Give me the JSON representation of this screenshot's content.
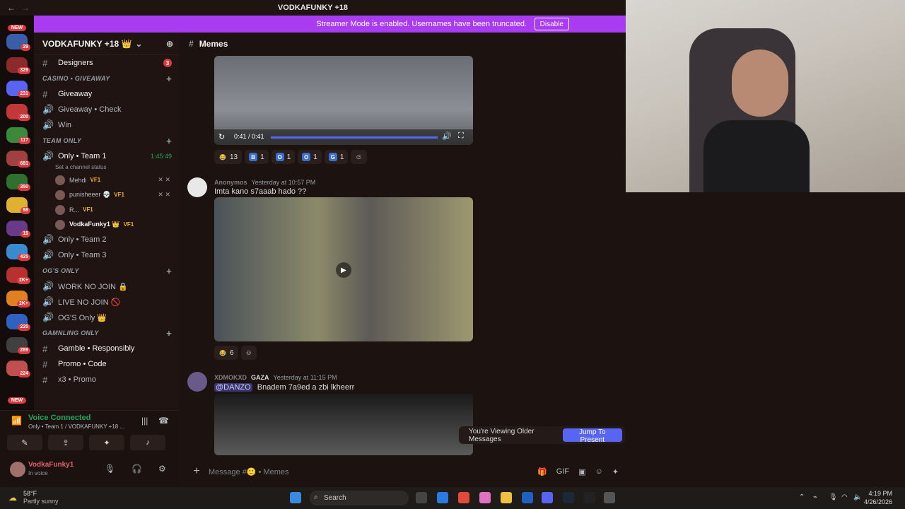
{
  "titlebar": {
    "title": "VODKAFUNKY +18"
  },
  "banner": {
    "text": "Streamer Mode is enabled. Usernames have been truncated.",
    "button": "Disable"
  },
  "server_rail": {
    "new_top": "NEW",
    "new_bottom": "NEW",
    "badges": [
      "29",
      "329",
      "231",
      "200",
      "117",
      "681",
      "350",
      "98",
      "15",
      "425",
      "2K+",
      "2K+",
      "220",
      "289",
      "224"
    ]
  },
  "sidebar": {
    "server_name": "VODKAFUNKY +18 👑",
    "channels": {
      "designers": {
        "label": "Designers",
        "count": "3"
      },
      "cat_casino": "CASINO • GIVEAWAY",
      "giveaway": "Giveaway",
      "giveaway_check": "Giveaway • Check",
      "win": "Win",
      "cat_team": "TEAM ONLY",
      "team1": {
        "label": "Only • Team 1",
        "timer": "1:45:49",
        "status": "Set a channel status"
      },
      "users": [
        {
          "name": "Mehdi",
          "tag": "VF1"
        },
        {
          "name": "punisheeer 💀",
          "tag": "VF1"
        },
        {
          "name": "R...",
          "tag": "VF1"
        },
        {
          "name": "VodkaFunky1 👑",
          "tag": "VF1"
        }
      ],
      "team2": "Only • Team 2",
      "team3": "Only • Team 3",
      "cat_ogs": "OG'S ONLY",
      "work": "WORK NO JOIN 🔒",
      "live": "LIVE NO JOIN 🚫",
      "ogs_only": "OG'S Only 👑",
      "cat_gambling": "GAMNLING ONLY",
      "gamble": "Gamble • Responsibly",
      "promo": "Promo • Code",
      "x3": "x3 • Promo"
    }
  },
  "voice": {
    "title": "Voice Connected",
    "sub": "Only • Team 1 / VODKAFUNKY +18 ..."
  },
  "user_panel": {
    "name": "VodkaFunky1",
    "status": "In voice"
  },
  "chat": {
    "channel": "Memes",
    "video1": {
      "time": "0:41 / 0:41"
    },
    "reactions1": [
      {
        "e": "😂",
        "c": "13"
      },
      {
        "e": "B",
        "c": "1"
      },
      {
        "e": "O",
        "c": "1"
      },
      {
        "e": "O",
        "c": "1"
      },
      {
        "e": "G",
        "c": "1"
      }
    ],
    "msg2": {
      "author": "Anonymos",
      "time": "Yesterday at 10:57 PM",
      "text": "Imta kano s7aaab hado ??"
    },
    "reactions2": [
      {
        "e": "😂",
        "c": "6"
      }
    ],
    "msg3": {
      "author": "XDMOKXD",
      "server_tag": "GAZA",
      "time": "Yesterday at 11:15 PM",
      "mention": "@DANZO",
      "text": "Bnadem 7a9ed a zbi lkheerr"
    },
    "older": {
      "text": "You're Viewing Older Messages",
      "button": "Jump To Present"
    },
    "composer_placeholder": "Message #🙂 • Memes"
  },
  "taskbar": {
    "weather_temp": "58°F",
    "weather_desc": "Partly sunny",
    "search": "Search",
    "time": "4:19 PM",
    "date": "4/26/2026"
  },
  "colors": {
    "accent": "#a93cf0",
    "blurple": "#5865f2",
    "green": "#23a55a",
    "red": "#d83c3e"
  }
}
